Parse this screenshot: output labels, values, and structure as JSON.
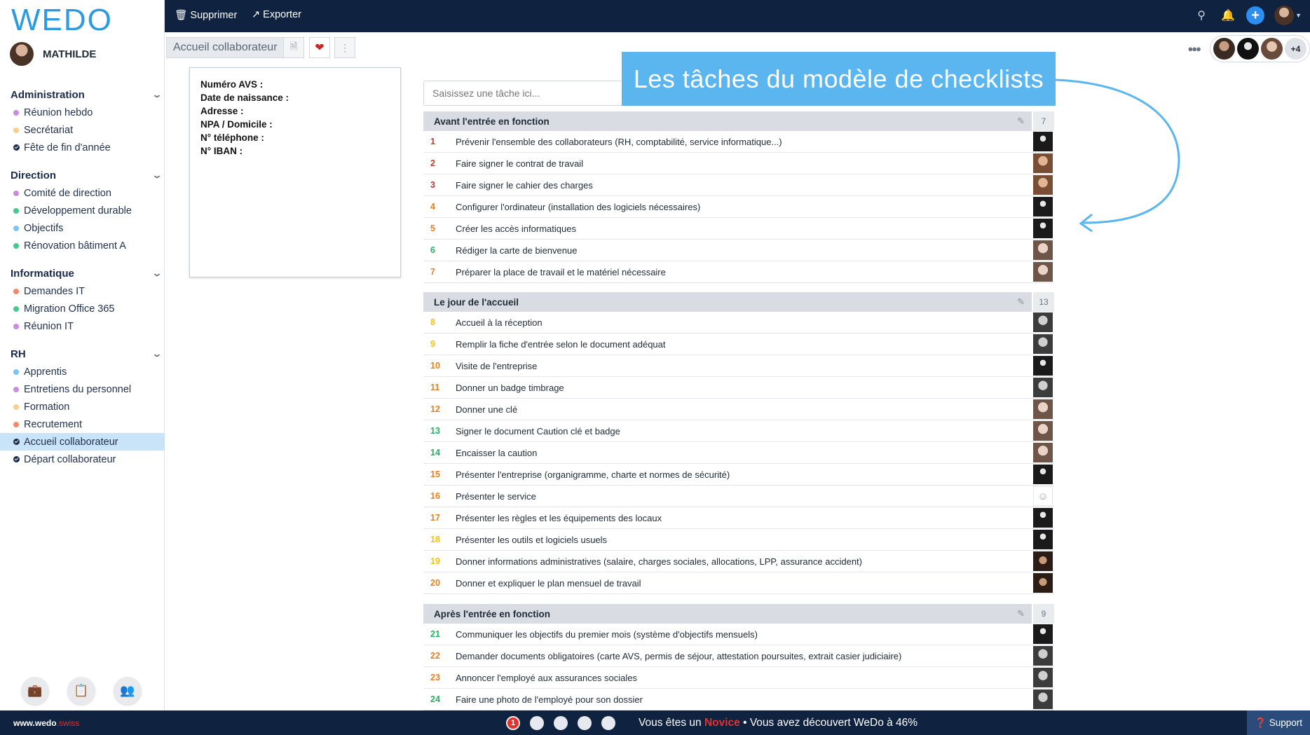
{
  "logo": "WEDO",
  "user": {
    "name": "MATHILDE"
  },
  "topbar": {
    "delete_label": "Supprimer",
    "export_label": "Exporter"
  },
  "sidebar": {
    "groups": [
      {
        "title": "Administration",
        "items": [
          {
            "label": "Réunion hebdo",
            "marker": "dot",
            "color": "#c98de0"
          },
          {
            "label": "Secrétariat",
            "marker": "dot",
            "color": "#f6d08a"
          },
          {
            "label": "Fête de fin d'année",
            "marker": "check",
            "color": "#1b2a4a"
          }
        ]
      },
      {
        "title": "Direction",
        "items": [
          {
            "label": "Comité de direction",
            "marker": "dot",
            "color": "#c98de0"
          },
          {
            "label": "Développement durable",
            "marker": "dot",
            "color": "#47c98e"
          },
          {
            "label": "Objectifs",
            "marker": "dot",
            "color": "#7ec3f3"
          },
          {
            "label": "Rénovation bâtiment A",
            "marker": "dot",
            "color": "#47c98e"
          }
        ]
      },
      {
        "title": "Informatique",
        "items": [
          {
            "label": "Demandes IT",
            "marker": "dot",
            "color": "#ef8a6a"
          },
          {
            "label": "Migration Office 365",
            "marker": "dot",
            "color": "#47c98e"
          },
          {
            "label": "Réunion IT",
            "marker": "dot",
            "color": "#c98de0"
          }
        ]
      },
      {
        "title": "RH",
        "items": [
          {
            "label": "Apprentis",
            "marker": "dot",
            "color": "#7ec3f3"
          },
          {
            "label": "Entretiens du personnel",
            "marker": "dot",
            "color": "#c98de0"
          },
          {
            "label": "Formation",
            "marker": "dot",
            "color": "#f6d08a"
          },
          {
            "label": "Recrutement",
            "marker": "dot",
            "color": "#ef8a6a"
          },
          {
            "label": "Accueil collaborateur",
            "marker": "check",
            "color": "#1b2a4a",
            "active": true
          },
          {
            "label": "Départ collaborateur",
            "marker": "check",
            "color": "#1b2a4a"
          }
        ]
      }
    ]
  },
  "subheader": {
    "title": "Accueil collaborateur",
    "members_more": "+4"
  },
  "info_card": {
    "lines": [
      "Numéro AVS :",
      "Date de naissance :",
      "Adresse :",
      "NPA / Domicile :",
      "N° téléphone :",
      "N° IBAN :"
    ]
  },
  "task_input": {
    "placeholder": "Saisissez une tâche ici..."
  },
  "callout": {
    "text": "Les tâches du modèle de checklists"
  },
  "sections": [
    {
      "title": "Avant l'entrée en fonction",
      "count": "7",
      "tasks": [
        {
          "num": "1",
          "text": "Prévenir l'ensemble des collaborateurs (RH, comptabilité, service informatique...)",
          "num_color": "#c0392b",
          "avatar": "a-dark"
        },
        {
          "num": "2",
          "text": "Faire signer le contrat de travail",
          "num_color": "#c0392b",
          "avatar": "a-woman"
        },
        {
          "num": "3",
          "text": "Faire signer le cahier des charges",
          "num_color": "#c0392b",
          "avatar": "a-woman"
        },
        {
          "num": "4",
          "text": "Configurer l'ordinateur (installation des logiciels nécessaires)",
          "num_color": "#e67e22",
          "avatar": "a-dark"
        },
        {
          "num": "5",
          "text": "Créer les accès informatiques",
          "num_color": "#e67e22",
          "avatar": "a-dark"
        },
        {
          "num": "6",
          "text": "Rédiger la carte de bienvenue",
          "num_color": "#27ae60",
          "avatar": "a-light"
        },
        {
          "num": "7",
          "text": "Préparer la place de travail et le matériel nécessaire",
          "num_color": "#e67e22",
          "avatar": "a-light"
        }
      ]
    },
    {
      "title": "Le jour de l'accueil",
      "count": "13",
      "tasks": [
        {
          "num": "8",
          "text": "Accueil à la réception",
          "num_color": "#f1c40f",
          "avatar": "a-bw"
        },
        {
          "num": "9",
          "text": "Remplir la fiche d'entrée selon le document adéquat",
          "num_color": "#f1c40f",
          "avatar": "a-bw"
        },
        {
          "num": "10",
          "text": "Visite de l'entreprise",
          "num_color": "#e67e22",
          "avatar": "a-dark"
        },
        {
          "num": "11",
          "text": "Donner un badge timbrage",
          "num_color": "#e67e22",
          "avatar": "a-bw"
        },
        {
          "num": "12",
          "text": "Donner une clé",
          "num_color": "#e67e22",
          "avatar": "a-light"
        },
        {
          "num": "13",
          "text": "Signer le document Caution clé et badge",
          "num_color": "#27ae60",
          "avatar": "a-light"
        },
        {
          "num": "14",
          "text": "Encaisser la caution",
          "num_color": "#27ae60",
          "avatar": "a-light"
        },
        {
          "num": "15",
          "text": "Présenter l'entreprise (organigramme, charte et normes de sécurité)",
          "num_color": "#e67e22",
          "avatar": "a-dark"
        },
        {
          "num": "16",
          "text": "Présenter le service",
          "num_color": "#e67e22",
          "avatar": "a-empty"
        },
        {
          "num": "17",
          "text": "Présenter les règles et les équipements des locaux",
          "num_color": "#e67e22",
          "avatar": "a-dark"
        },
        {
          "num": "18",
          "text": "Présenter les outils et logiciels usuels",
          "num_color": "#f1c40f",
          "avatar": "a-dark"
        },
        {
          "num": "19",
          "text": "Donner informations administratives (salaire, charges sociales, allocations, LPP, assurance accident)",
          "num_color": "#f1c40f",
          "avatar": "a-curly"
        },
        {
          "num": "20",
          "text": "Donner et expliquer le plan mensuel de travail",
          "num_color": "#e67e22",
          "avatar": "a-curly"
        }
      ]
    },
    {
      "title": "Après l'entrée en fonction",
      "count": "9",
      "tasks": [
        {
          "num": "21",
          "text": "Communiquer les objectifs du premier mois (système d'objectifs mensuels)",
          "num_color": "#27ae60",
          "avatar": "a-dark"
        },
        {
          "num": "22",
          "text": "Demander documents obligatoires (carte AVS, permis de séjour, attestation poursuites, extrait casier judiciaire)",
          "num_color": "#e67e22",
          "avatar": "a-bw"
        },
        {
          "num": "23",
          "text": "Annoncer l'employé aux assurances sociales",
          "num_color": "#e67e22",
          "avatar": "a-bw"
        },
        {
          "num": "24",
          "text": "Faire une photo de l'employé pour son dossier",
          "num_color": "#27ae60",
          "avatar": "a-bw"
        }
      ]
    }
  ],
  "footer": {
    "site_main": "www.wedo",
    "site_tld": ".swiss",
    "first_step": "1",
    "progress_prefix": "Vous êtes un ",
    "level": "Novice",
    "progress_suffix": " • Vous avez découvert WeDo à 46%",
    "progress_value": 46,
    "support_label": "Support"
  }
}
